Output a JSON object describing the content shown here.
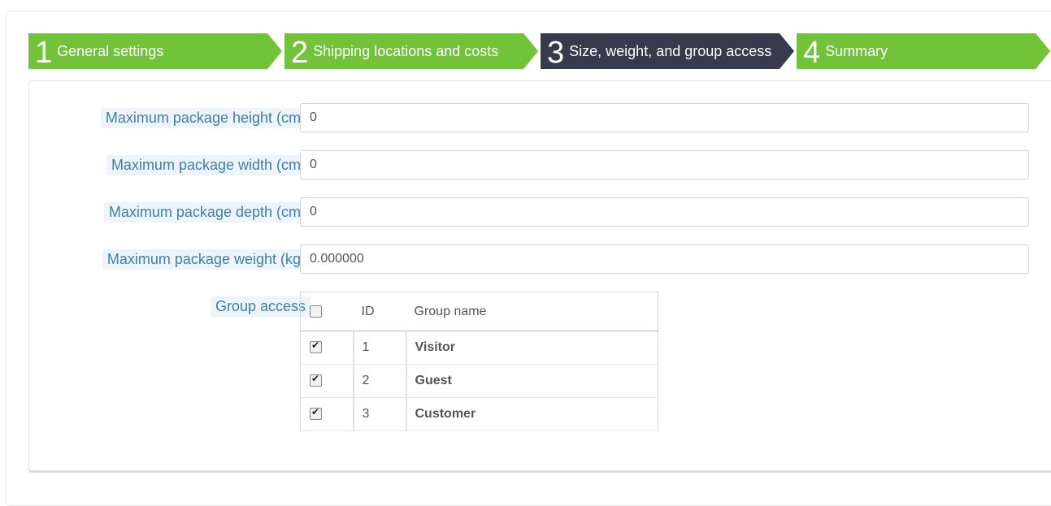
{
  "steps": [
    {
      "num": "1",
      "label": "General settings",
      "state": "done"
    },
    {
      "num": "2",
      "label": "Shipping locations and costs",
      "state": "done"
    },
    {
      "num": "3",
      "label": "Size, weight, and group access",
      "state": "active"
    },
    {
      "num": "4",
      "label": "Summary",
      "state": "done"
    }
  ],
  "form": {
    "height": {
      "label": "Maximum package height (cm)",
      "value": "0"
    },
    "width": {
      "label": "Maximum package width (cm)",
      "value": "0"
    },
    "depth": {
      "label": "Maximum package depth (cm)",
      "value": "0"
    },
    "weight": {
      "label": "Maximum package weight (kg)",
      "value": "0.000000"
    },
    "group_access_label": "Group access"
  },
  "group_table": {
    "headers": {
      "id": "ID",
      "name": "Group name"
    },
    "select_all_checked": false,
    "rows": [
      {
        "id": "1",
        "name": "Visitor",
        "checked": true
      },
      {
        "id": "2",
        "name": "Guest",
        "checked": true
      },
      {
        "id": "3",
        "name": "Customer",
        "checked": true
      }
    ]
  },
  "colors": {
    "step_done": "#72c23a",
    "step_active": "#363a4b",
    "label_text": "#3f7fa8",
    "label_bg": "#eef5fa"
  }
}
